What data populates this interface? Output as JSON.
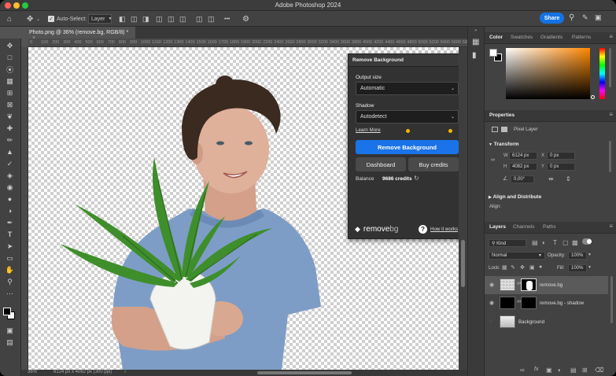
{
  "window": {
    "title": "Adobe Photoshop 2024"
  },
  "options_bar": {
    "auto_select_label": "Auto-Select:",
    "auto_select_value": "Layer",
    "more": "•••",
    "share_label": "Share"
  },
  "document": {
    "tab_label": "Photo.png @ 36% (remove.bg, RGB/8) *",
    "close_icon": "×",
    "ruler_ticks": [
      "0",
      "100",
      "200",
      "300",
      "400",
      "500",
      "600",
      "700",
      "800",
      "900",
      "1000",
      "1100",
      "1200",
      "1300",
      "1400",
      "1500",
      "1600",
      "1700",
      "1800",
      "1900",
      "2000",
      "2200",
      "2400",
      "2600",
      "2800",
      "3000",
      "3200",
      "3400",
      "3600",
      "3800",
      "4000",
      "4200",
      "4400",
      "4600",
      "4800",
      "5000",
      "5200",
      "5400",
      "5600",
      "5800"
    ]
  },
  "status": {
    "zoom": "36%",
    "doc_info": "6124 px x 4082 px (300 ppi)",
    "arrow": "›"
  },
  "remove_bg_panel": {
    "title": "Remove Background",
    "output_size_label": "Output size",
    "output_size_value": "Automatic",
    "shadow_label": "Shadow",
    "shadow_value": "Autodetect",
    "learn_more": "Learn More",
    "remove_button": "Remove Background",
    "dashboard_button": "Dashboard",
    "buy_credits_button": "Buy credits",
    "balance_label": "Balance",
    "balance_value": "9686 credits",
    "logo_text": "remove",
    "logo_text_suffix": "bg",
    "how_it_works": "How it works",
    "accent": "#1a73e8",
    "dot_color": "#f5b800"
  },
  "color_panel": {
    "tabs": [
      "Color",
      "Swatches",
      "Gradients",
      "Patterns"
    ]
  },
  "properties_panel": {
    "title": "Properties",
    "kind": "Pixel Layer",
    "transform_label": "Transform",
    "w_label": "W",
    "w_value": "6124 px",
    "h_label": "H",
    "h_value": "4082 px",
    "x_label": "X",
    "x_value": "0 px",
    "y_label": "Y",
    "y_value": "0 px",
    "angle_value": "0,00°",
    "align_label": "Align and Distribute",
    "align_sub": "Align:"
  },
  "layers_panel": {
    "tabs": [
      "Layers",
      "Channels",
      "Paths"
    ],
    "kind_label": "Kind",
    "blend_mode": "Normal",
    "opacity_label": "Opacity:",
    "opacity_value": "100%",
    "lock_label": "Lock:",
    "fill_label": "Fill:",
    "fill_value": "100%",
    "layers": [
      {
        "name": "remove.bg",
        "visible": true,
        "selected": true
      },
      {
        "name": "remove.bg - shadow",
        "visible": true,
        "selected": false
      },
      {
        "name": "Background",
        "visible": false,
        "selected": false
      }
    ],
    "footer_fx": "fx"
  },
  "colors": {
    "accent": "#1473e6",
    "panel_bg": "#424242",
    "canvas_bg": "#535353"
  }
}
